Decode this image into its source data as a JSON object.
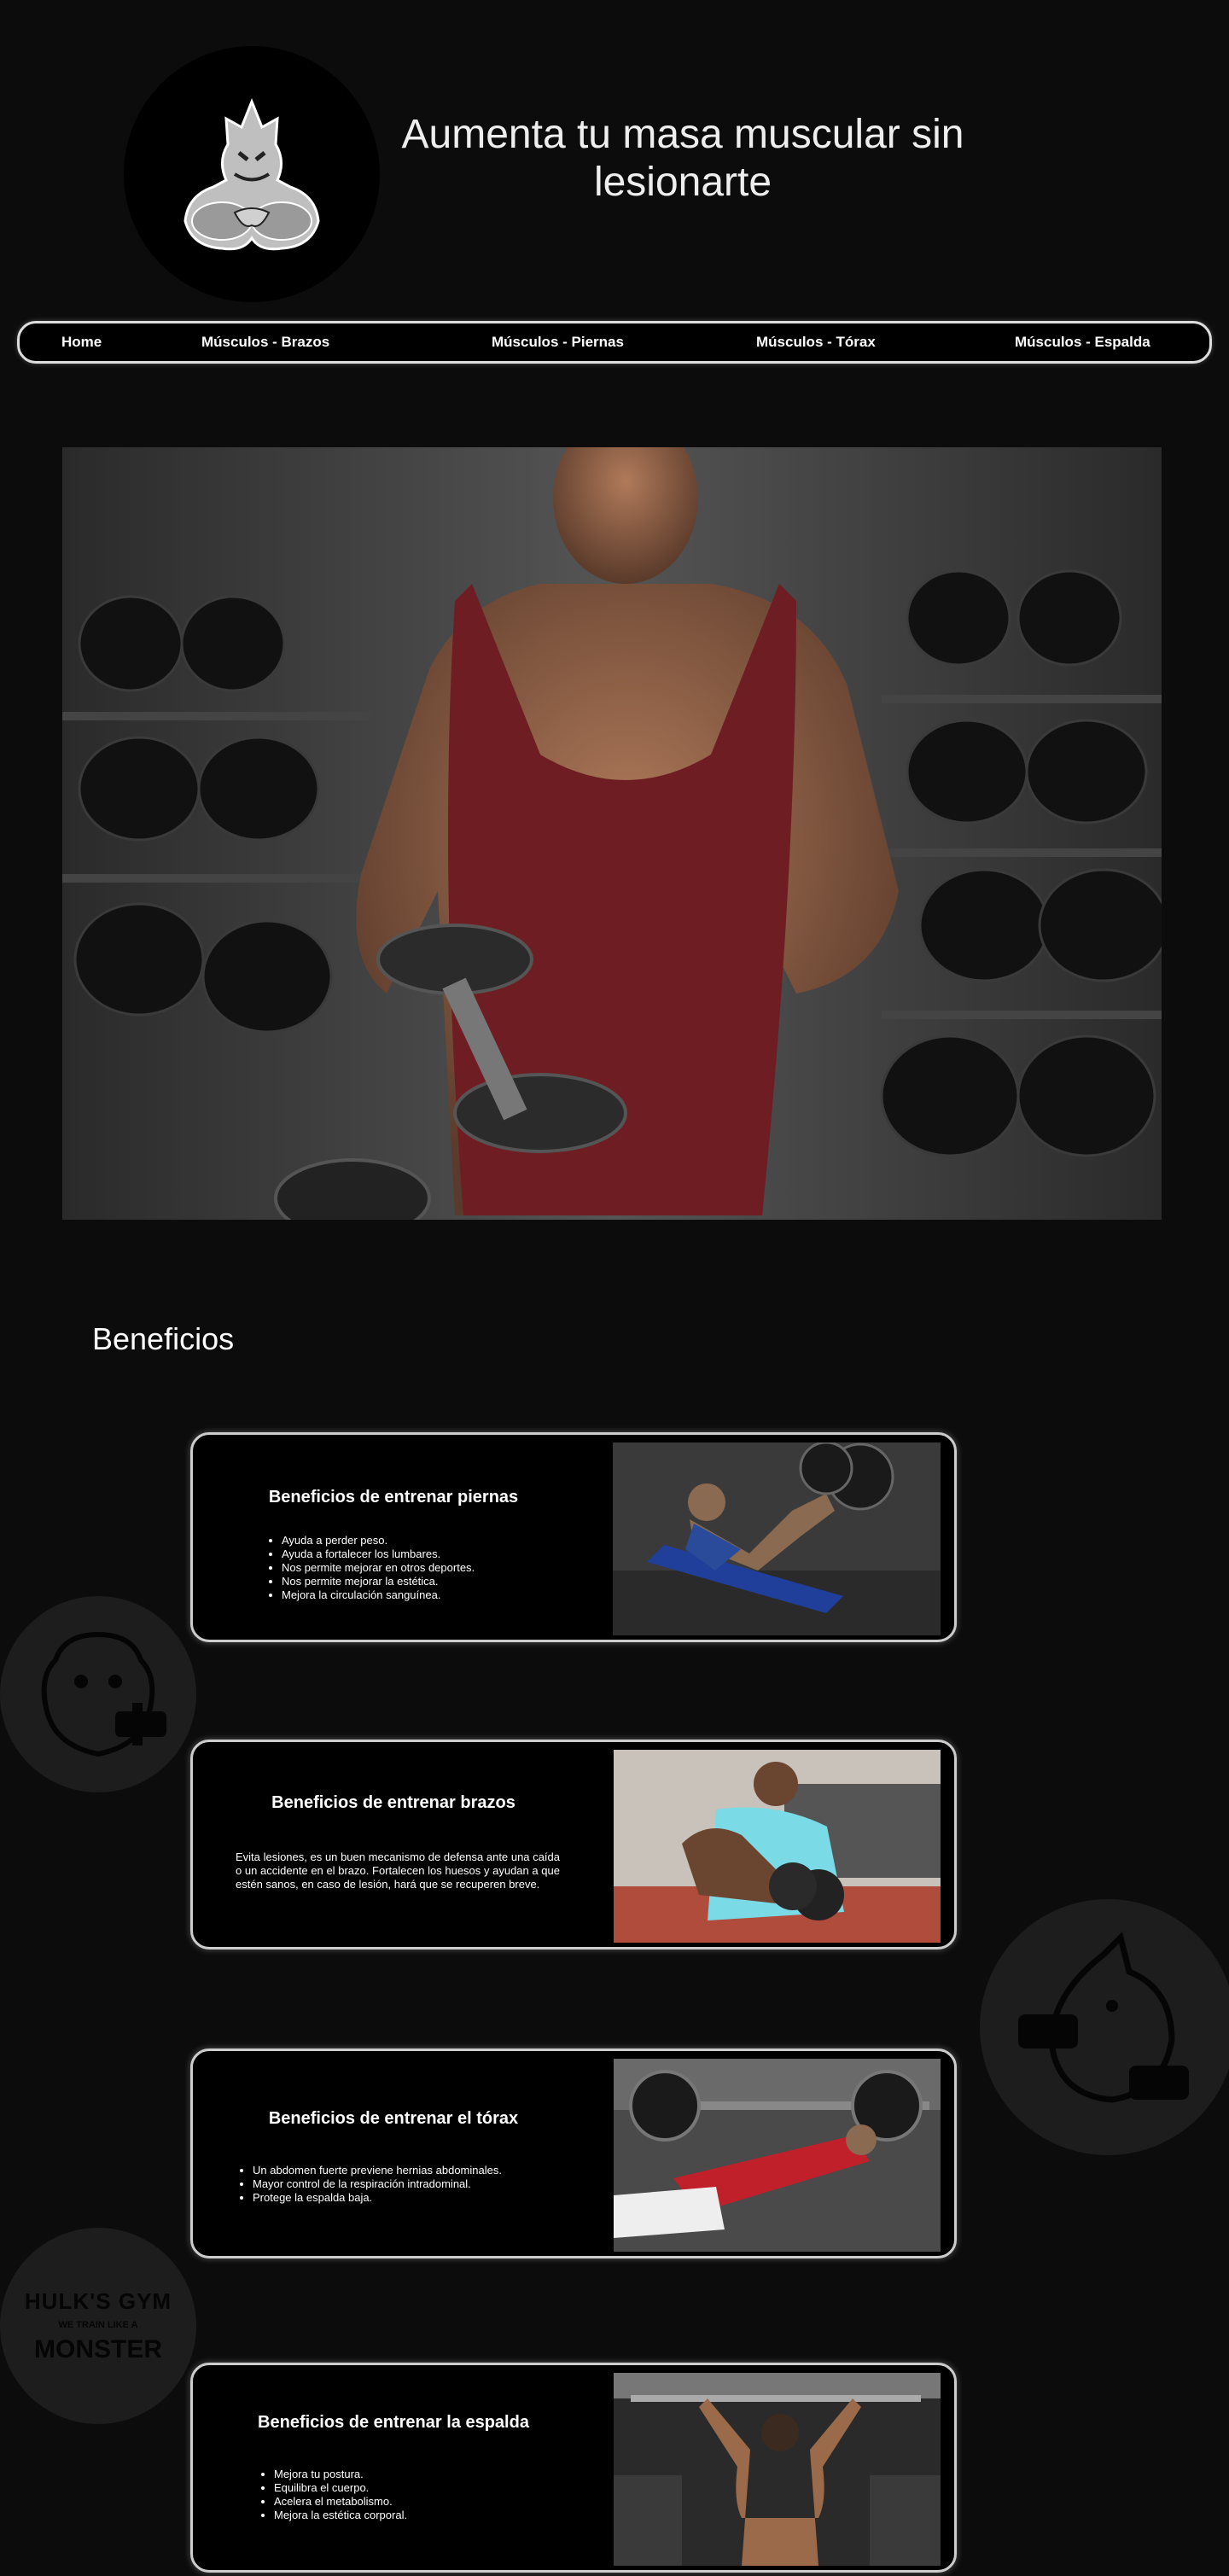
{
  "header": {
    "title": "Aumenta tu masa muscular sin lesionarte",
    "logo_icon": "rhino-mascot-logo"
  },
  "nav": {
    "items": [
      {
        "label": "Home"
      },
      {
        "label": "Músculos - Brazos"
      },
      {
        "label": "Músculos - Piernas"
      },
      {
        "label": "Músculos - Tórax"
      },
      {
        "label": "Músculos - Espalda"
      }
    ]
  },
  "hero": {
    "image": "bodybuilder-dumbbell-curl-photo"
  },
  "section": {
    "title": "Beneficios"
  },
  "cards": [
    {
      "title": "Beneficios de entrenar piernas",
      "items": [
        "Ayuda a perder peso.",
        "Ayuda a fortalecer los lumbares.",
        "Nos permite mejorar en otros deportes.",
        "Nos permite mejorar la estética.",
        "Mejora la circulación sanguínea."
      ],
      "image": "leg-press-photo"
    },
    {
      "title": "Beneficios de entrenar brazos",
      "body": "Evita lesiones, es un buen mecanismo de defensa ante una caída o un accidente en el brazo. Fortalecen los huesos y ayudan a que estén sanos, en caso de lesión, hará que se recuperen breve.",
      "image": "bicep-curl-photo"
    },
    {
      "title": "Beneficios de entrenar el tórax",
      "items": [
        "Un abdomen fuerte previene hernias abdominales.",
        "Mayor control de la respiración intradominal.",
        "Protege la espalda baja."
      ],
      "image": "bench-press-photo"
    },
    {
      "title": "Beneficios de entrenar la espalda",
      "items": [
        "Mejora tu postura.",
        "Equilibra el cuerpo.",
        "Acelera el metabolismo.",
        "Mejora la estética corporal."
      ],
      "image": "back-pullup-photo"
    }
  ],
  "decorations": {
    "gorilla_badge": "gorilla-dumbbell-icon",
    "rhino_badge": "rhino-dumbbell-icon",
    "gym_badge": {
      "line1": "HULK'S GYM",
      "line2": "WE TRAIN LIKE A",
      "line3": "MONSTER"
    }
  },
  "colors": {
    "background": "#0c0c0c",
    "card_border": "#cccccc",
    "tank_top": "#6e1d22"
  }
}
